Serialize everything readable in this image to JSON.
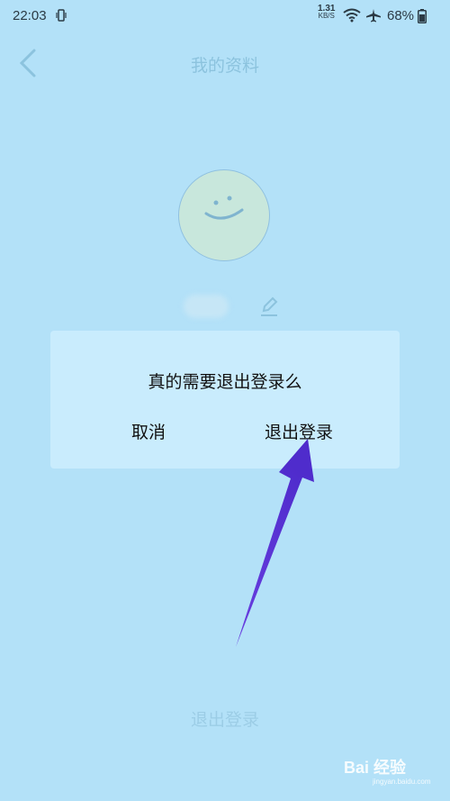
{
  "status_bar": {
    "time": "22:03",
    "net_speed_value": "1.31",
    "net_speed_unit": "KB/S",
    "battery": "68%",
    "icons": [
      "vibrate-icon",
      "wifi-icon",
      "airplane-icon",
      "battery-icon"
    ]
  },
  "header": {
    "title": "我的资料",
    "back_icon": "chevron-left-icon"
  },
  "profile": {
    "avatar_icon": "smiley-avatar",
    "edit_icon": "pencil-icon"
  },
  "dialog": {
    "title": "真的需要退出登录么",
    "cancel_label": "取消",
    "confirm_label": "退出登录"
  },
  "footer": {
    "logout_label": "退出登录"
  },
  "watermark": {
    "brand": "Bai 经验",
    "url": "jingyan.baidu.com"
  },
  "colors": {
    "background": "#b3e1f8",
    "dialog": "#c9ecfd",
    "arrow": "#5b2fd6"
  }
}
